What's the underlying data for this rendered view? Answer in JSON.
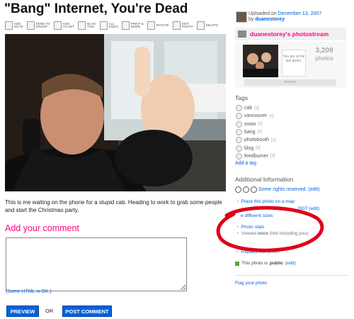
{
  "title": "\"Bang\" Internet, You're Dead",
  "toolbar": [
    {
      "label": "ADD\nNOTE",
      "icon": "note-icon"
    },
    {
      "label": "SEND TO\nGROUP",
      "icon": "group-icon"
    },
    {
      "label": "ADD\nTO SET",
      "icon": "set-icon"
    },
    {
      "label": "BLOG\nTHIS",
      "icon": "blog-icon"
    },
    {
      "label": "ALL\nSIZES",
      "icon": "sizes-icon"
    },
    {
      "label": "PRINT &\nMORE",
      "icon": "print-icon"
    },
    {
      "label": "ROTATE",
      "icon": "rotate-icon"
    },
    {
      "label": "EDIT\nPHOTO",
      "icon": "edit-icon"
    },
    {
      "label": "DELETE",
      "icon": "delete-icon"
    }
  ],
  "caption": "This is me waiting on the phone for a stupid cab. Heading to work to grab some people and start the Christmas party.",
  "add_comment": "Add your comment",
  "html_ok": "(Some HTML is OK.)",
  "preview": "PREVIEW",
  "or": "OR",
  "post_comment": "POST COMMENT",
  "sidebar": {
    "uploaded_prefix": "Uploaded on",
    "uploaded_date": "December 13, 2007",
    "by_prefix": "by",
    "by_user": "duanestorey",
    "stream_title": "duanestorey's photostream",
    "last_photo": "You are at the last photo.",
    "photo_count": "3,209",
    "photos_label": "photos",
    "browse": "browse",
    "tags_heading": "Tags",
    "tags": [
      "cab",
      "vancouver",
      "snow",
      "bang",
      "photobooth",
      "blog",
      "feedburner"
    ],
    "tag_remove": "[x]",
    "add_tag": "Add a tag",
    "addinfo_heading": "Additional Information",
    "rights": "Some rights reserved.",
    "edit": "(edit)",
    "place_map": "Place this photo on a map",
    "taken_date": "2007",
    "different_sizes": "e different sizes",
    "photo_stats": "Photo stats",
    "viewed_prefix": "Viewed ",
    "viewed_count": "once",
    "viewed_suffix": " (Not including you)",
    "replace": "Replace",
    "replace_suffix": " this photo",
    "public_prefix": "This photo is ",
    "public_word": "public",
    "flag": "Flag your photo"
  },
  "colors": {
    "link": "#0063dc",
    "pink": "#ff0084",
    "annotation": "#e0001a"
  }
}
